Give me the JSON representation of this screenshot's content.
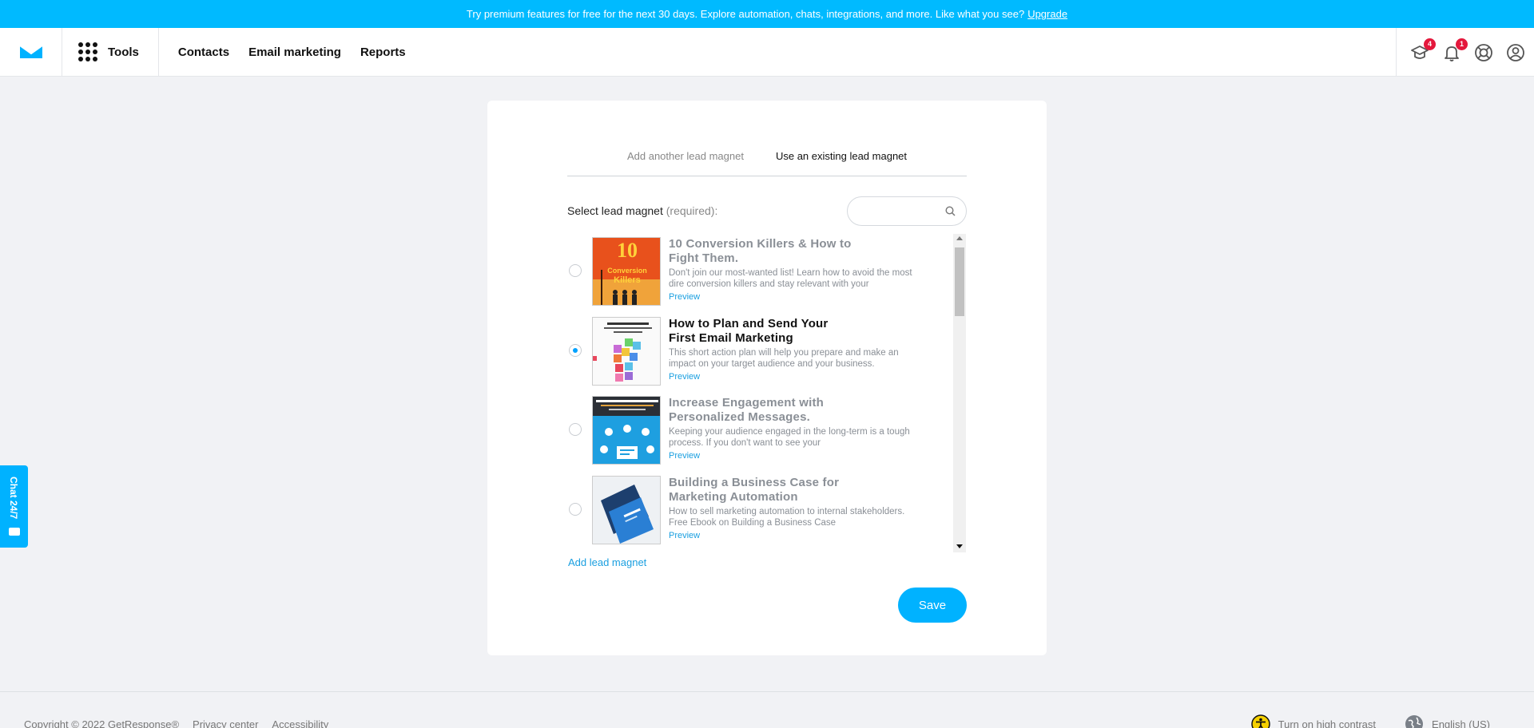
{
  "promo": {
    "text": "Try premium features for free for the next 30 days. Explore automation, chats, integrations, and more. Like what you see?",
    "link": "Upgrade"
  },
  "nav": {
    "tools": "Tools",
    "links": [
      "Contacts",
      "Email marketing",
      "Reports"
    ],
    "badges": {
      "academy": "4",
      "notifications": "1"
    }
  },
  "tabs": [
    "Add another lead magnet",
    "Use an existing lead magnet"
  ],
  "form": {
    "select_label": "Select lead magnet",
    "required": "(required):",
    "search_placeholder": ""
  },
  "items": [
    {
      "title": "10 Conversion Killers & How to Fight Them.",
      "desc": "Don't join our most-wanted list! Learn how to avoid the most dire conversion killers and stay relevant with your",
      "preview": "Preview",
      "selected": false
    },
    {
      "title": "How to Plan and Send Your First Email Marketing",
      "desc": "This short action plan will help you prepare and make an impact on your target audience and your business.",
      "preview": "Preview",
      "selected": true
    },
    {
      "title": "Increase Engagement with Personalized Messages.",
      "desc": "Keeping your audience engaged in the long-term is a tough process. If you don't want to see your",
      "preview": "Preview",
      "selected": false
    },
    {
      "title": "Building a Business Case for Marketing Automation",
      "desc": "How to sell marketing automation to internal stakeholders. Free Ebook on Building a Business Case",
      "preview": "Preview",
      "selected": false
    }
  ],
  "add_link": "Add lead magnet",
  "save": "Save",
  "chat": "Chat 24/7",
  "footer": {
    "copyright": "Copyright © 2022 GetResponse®",
    "privacy": "Privacy center",
    "accessibility": "Accessibility",
    "contrast": "Turn on high contrast",
    "language": "English (US)"
  },
  "colors": {
    "accent": "#00b2ff",
    "promo": "#00baff",
    "badge": "#e4183c"
  }
}
